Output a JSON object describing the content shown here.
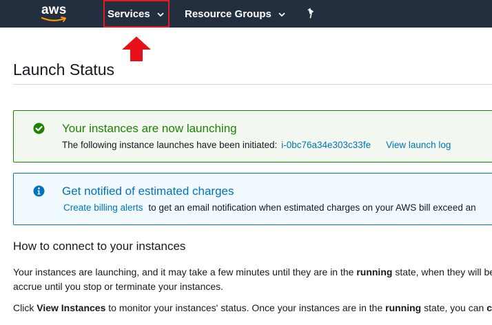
{
  "nav": {
    "logo_text": "aws",
    "services_label": "Services",
    "resource_groups_label": "Resource Groups"
  },
  "page": {
    "title": "Launch Status"
  },
  "success_alert": {
    "heading": "Your instances are now launching",
    "body_prefix": "The following instance launches have been initiated:",
    "instance_id": "i-0bc76a34e303c33fe",
    "view_log_label": "View launch log"
  },
  "info_alert": {
    "heading": "Get notified of estimated charges",
    "billing_link": "Create billing alerts",
    "body_suffix": "to get an email notification when estimated charges on your AWS bill exceed an"
  },
  "connect": {
    "heading": "How to connect to your instances",
    "para1_a": "Your instances are launching, and it may take a few minutes until they are in the ",
    "para1_b": "running",
    "para1_c": " state, when they will be",
    "para2": "accrue until you stop or terminate your instances.",
    "para3_a": "Click ",
    "para3_b": "View Instances",
    "para3_c": " to monitor your instances' status. Once your instances are in the ",
    "para3_d": "running",
    "para3_e": " state, you can ",
    "para3_f": "c"
  },
  "colors": {
    "nav_bg": "#232f3e",
    "success": "#1d8102",
    "info": "#0073bb",
    "highlight": "#e51c23"
  }
}
